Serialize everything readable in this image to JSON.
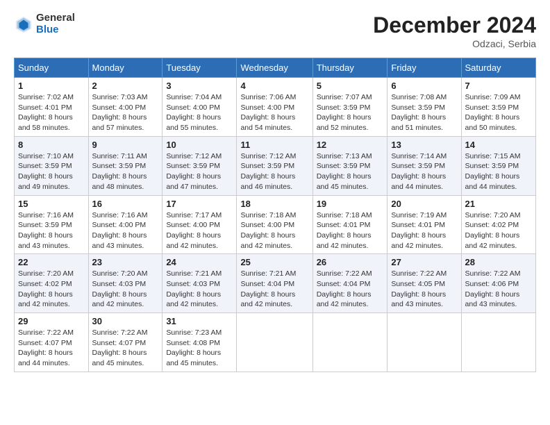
{
  "logo": {
    "general": "General",
    "blue": "Blue"
  },
  "title": "December 2024",
  "location": "Odzaci, Serbia",
  "headers": [
    "Sunday",
    "Monday",
    "Tuesday",
    "Wednesday",
    "Thursday",
    "Friday",
    "Saturday"
  ],
  "weeks": [
    [
      {
        "day": "1",
        "info": "Sunrise: 7:02 AM\nSunset: 4:01 PM\nDaylight: 8 hours\nand 58 minutes."
      },
      {
        "day": "2",
        "info": "Sunrise: 7:03 AM\nSunset: 4:00 PM\nDaylight: 8 hours\nand 57 minutes."
      },
      {
        "day": "3",
        "info": "Sunrise: 7:04 AM\nSunset: 4:00 PM\nDaylight: 8 hours\nand 55 minutes."
      },
      {
        "day": "4",
        "info": "Sunrise: 7:06 AM\nSunset: 4:00 PM\nDaylight: 8 hours\nand 54 minutes."
      },
      {
        "day": "5",
        "info": "Sunrise: 7:07 AM\nSunset: 3:59 PM\nDaylight: 8 hours\nand 52 minutes."
      },
      {
        "day": "6",
        "info": "Sunrise: 7:08 AM\nSunset: 3:59 PM\nDaylight: 8 hours\nand 51 minutes."
      },
      {
        "day": "7",
        "info": "Sunrise: 7:09 AM\nSunset: 3:59 PM\nDaylight: 8 hours\nand 50 minutes."
      }
    ],
    [
      {
        "day": "8",
        "info": "Sunrise: 7:10 AM\nSunset: 3:59 PM\nDaylight: 8 hours\nand 49 minutes."
      },
      {
        "day": "9",
        "info": "Sunrise: 7:11 AM\nSunset: 3:59 PM\nDaylight: 8 hours\nand 48 minutes."
      },
      {
        "day": "10",
        "info": "Sunrise: 7:12 AM\nSunset: 3:59 PM\nDaylight: 8 hours\nand 47 minutes."
      },
      {
        "day": "11",
        "info": "Sunrise: 7:12 AM\nSunset: 3:59 PM\nDaylight: 8 hours\nand 46 minutes."
      },
      {
        "day": "12",
        "info": "Sunrise: 7:13 AM\nSunset: 3:59 PM\nDaylight: 8 hours\nand 45 minutes."
      },
      {
        "day": "13",
        "info": "Sunrise: 7:14 AM\nSunset: 3:59 PM\nDaylight: 8 hours\nand 44 minutes."
      },
      {
        "day": "14",
        "info": "Sunrise: 7:15 AM\nSunset: 3:59 PM\nDaylight: 8 hours\nand 44 minutes."
      }
    ],
    [
      {
        "day": "15",
        "info": "Sunrise: 7:16 AM\nSunset: 3:59 PM\nDaylight: 8 hours\nand 43 minutes."
      },
      {
        "day": "16",
        "info": "Sunrise: 7:16 AM\nSunset: 4:00 PM\nDaylight: 8 hours\nand 43 minutes."
      },
      {
        "day": "17",
        "info": "Sunrise: 7:17 AM\nSunset: 4:00 PM\nDaylight: 8 hours\nand 42 minutes."
      },
      {
        "day": "18",
        "info": "Sunrise: 7:18 AM\nSunset: 4:00 PM\nDaylight: 8 hours\nand 42 minutes."
      },
      {
        "day": "19",
        "info": "Sunrise: 7:18 AM\nSunset: 4:01 PM\nDaylight: 8 hours\nand 42 minutes."
      },
      {
        "day": "20",
        "info": "Sunrise: 7:19 AM\nSunset: 4:01 PM\nDaylight: 8 hours\nand 42 minutes."
      },
      {
        "day": "21",
        "info": "Sunrise: 7:20 AM\nSunset: 4:02 PM\nDaylight: 8 hours\nand 42 minutes."
      }
    ],
    [
      {
        "day": "22",
        "info": "Sunrise: 7:20 AM\nSunset: 4:02 PM\nDaylight: 8 hours\nand 42 minutes."
      },
      {
        "day": "23",
        "info": "Sunrise: 7:20 AM\nSunset: 4:03 PM\nDaylight: 8 hours\nand 42 minutes."
      },
      {
        "day": "24",
        "info": "Sunrise: 7:21 AM\nSunset: 4:03 PM\nDaylight: 8 hours\nand 42 minutes."
      },
      {
        "day": "25",
        "info": "Sunrise: 7:21 AM\nSunset: 4:04 PM\nDaylight: 8 hours\nand 42 minutes."
      },
      {
        "day": "26",
        "info": "Sunrise: 7:22 AM\nSunset: 4:04 PM\nDaylight: 8 hours\nand 42 minutes."
      },
      {
        "day": "27",
        "info": "Sunrise: 7:22 AM\nSunset: 4:05 PM\nDaylight: 8 hours\nand 43 minutes."
      },
      {
        "day": "28",
        "info": "Sunrise: 7:22 AM\nSunset: 4:06 PM\nDaylight: 8 hours\nand 43 minutes."
      }
    ],
    [
      {
        "day": "29",
        "info": "Sunrise: 7:22 AM\nSunset: 4:07 PM\nDaylight: 8 hours\nand 44 minutes."
      },
      {
        "day": "30",
        "info": "Sunrise: 7:22 AM\nSunset: 4:07 PM\nDaylight: 8 hours\nand 45 minutes."
      },
      {
        "day": "31",
        "info": "Sunrise: 7:23 AM\nSunset: 4:08 PM\nDaylight: 8 hours\nand 45 minutes."
      },
      {
        "day": "",
        "info": ""
      },
      {
        "day": "",
        "info": ""
      },
      {
        "day": "",
        "info": ""
      },
      {
        "day": "",
        "info": ""
      }
    ]
  ]
}
